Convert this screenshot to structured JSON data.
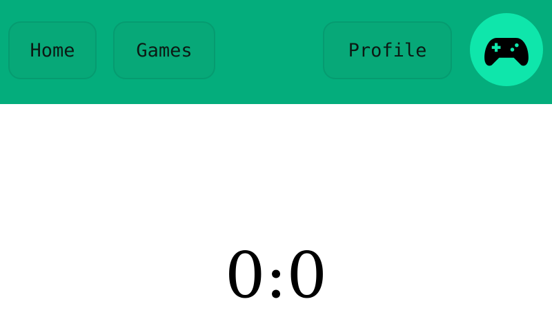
{
  "header": {
    "nav": {
      "home_label": "Home",
      "games_label": "Games",
      "profile_label": "Profile"
    },
    "avatar_icon": "gamepad-icon",
    "background_color": "#04ad7c",
    "avatar_color": "#0fe6ab"
  },
  "main": {
    "score": "0:0"
  }
}
